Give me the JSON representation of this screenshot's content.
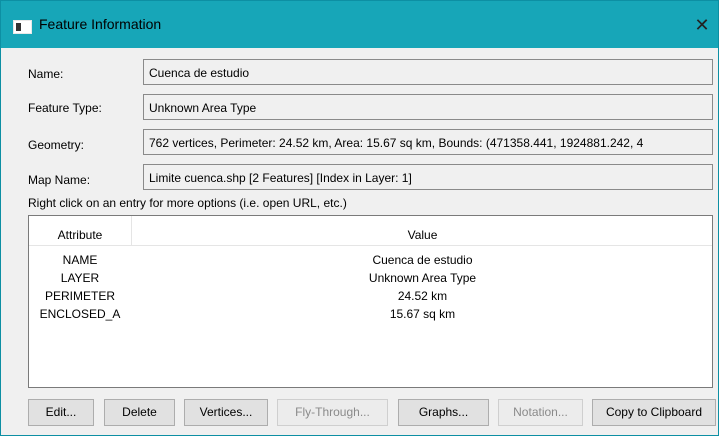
{
  "window": {
    "title": "Feature Information",
    "close_symbol": "✕"
  },
  "fields": {
    "name": {
      "label": "Name:",
      "value": "Cuenca de estudio"
    },
    "feature_type": {
      "label": "Feature Type:",
      "value": "Unknown Area Type"
    },
    "geometry": {
      "label": "Geometry:",
      "value": "762 vertices, Perimeter: 24.52 km, Area: 15.67 sq km, Bounds: (471358.441, 1924881.242, 4"
    },
    "map_name": {
      "label": "Map Name:",
      "value": "Limite cuenca.shp [2 Features] [Index in Layer: 1]"
    }
  },
  "hint": "Right click on an entry for more options (i.e. open URL, etc.)",
  "table": {
    "columns": [
      "Attribute",
      "Value"
    ],
    "rows": [
      {
        "attribute": "NAME",
        "value": "Cuenca de estudio"
      },
      {
        "attribute": "LAYER",
        "value": "Unknown Area Type"
      },
      {
        "attribute": "PERIMETER",
        "value": "24.52 km"
      },
      {
        "attribute": "ENCLOSED_A",
        "value": "15.67 sq km"
      }
    ]
  },
  "buttons": {
    "edit": "Edit...",
    "delete": "Delete",
    "vertices": "Vertices...",
    "fly_through": "Fly-Through...",
    "graphs": "Graphs...",
    "notation": "Notation...",
    "copy": "Copy to Clipboard"
  }
}
